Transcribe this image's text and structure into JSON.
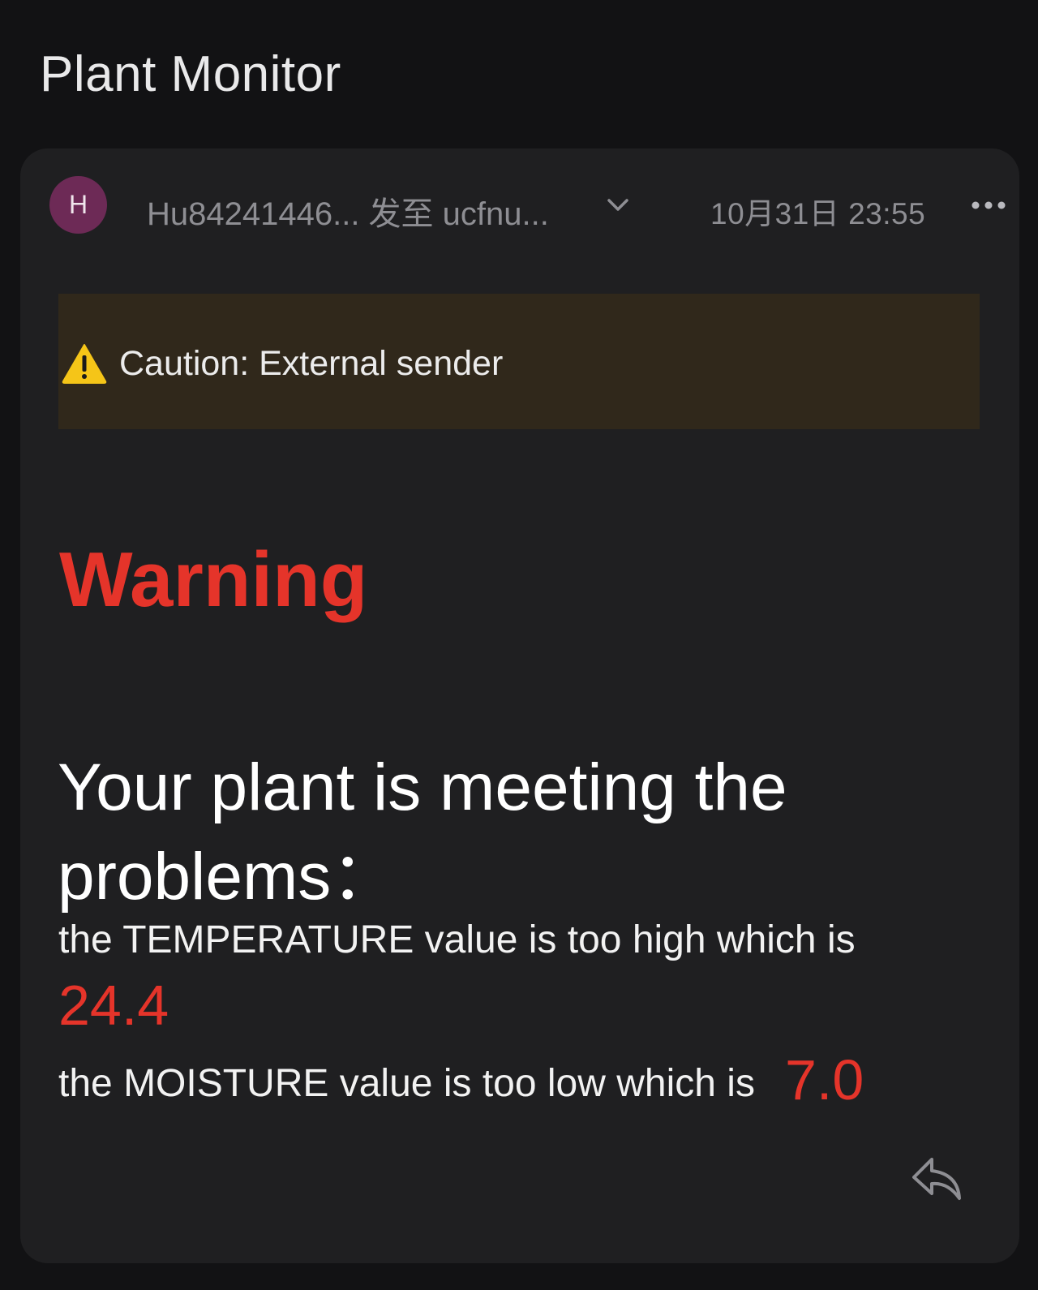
{
  "app": {
    "title": "Plant Monitor"
  },
  "email": {
    "avatar_letter": "H",
    "sender_line": "Hu84241446... 发至 ucfnu...",
    "date": "10月31日 23:55",
    "caution_text": "Caution: External sender",
    "warning_heading": "Warning",
    "problems_heading": "Your plant is meeting the problems：",
    "temperature_line": "the TEMPERATURE value is too high which is",
    "temperature_value": "24.4",
    "moisture_line": "the MOISTURE value is too low which is",
    "moisture_value": "7.0"
  },
  "icons": {
    "expand": "chevron-down-icon",
    "more": "more-icon",
    "caution": "warning-triangle-icon",
    "reply": "reply-icon"
  },
  "colors": {
    "background": "#121214",
    "card": "#1f1f21",
    "avatar": "#6d2a56",
    "caution_banner": "#30281b",
    "alert_red": "#e5342a",
    "muted_text": "#8e8e93"
  }
}
